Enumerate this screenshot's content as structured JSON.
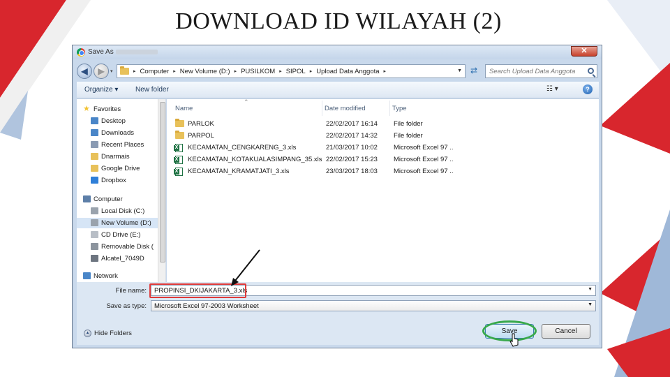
{
  "slide": {
    "title": "DOWNLOAD ID WILAYAH (2)"
  },
  "dialog": {
    "title": "Save As",
    "close_label": "✕",
    "breadcrumbs": [
      "Computer",
      "New Volume (D:)",
      "PUSILKOM",
      "SIPOL",
      "Upload Data Anggota"
    ],
    "search_placeholder": "Search Upload Data Anggota",
    "toolbar": {
      "organize": "Organize ▾",
      "new_folder": "New folder",
      "view": "☷ ▾",
      "help": "?"
    },
    "nav_pane": [
      {
        "label": "Favorites",
        "icon": "star-icon",
        "indent": 0,
        "selected": false
      },
      {
        "label": "Desktop",
        "icon": "desktop-icon",
        "indent": 1,
        "selected": false
      },
      {
        "label": "Downloads",
        "icon": "downloads-icon",
        "indent": 1,
        "selected": false
      },
      {
        "label": "Recent Places",
        "icon": "recent-places-icon",
        "indent": 1,
        "selected": false
      },
      {
        "label": "Dnarmais",
        "icon": "folder-icon",
        "indent": 1,
        "selected": false
      },
      {
        "label": "Google Drive",
        "icon": "google-drive-icon",
        "indent": 1,
        "selected": false
      },
      {
        "label": "Dropbox",
        "icon": "dropbox-icon",
        "indent": 1,
        "selected": false
      },
      {
        "label": "Computer",
        "icon": "computer-icon",
        "indent": 0,
        "selected": false
      },
      {
        "label": "Local Disk (C:)",
        "icon": "disk-icon",
        "indent": 1,
        "selected": false
      },
      {
        "label": "New Volume (D:)",
        "icon": "disk-icon",
        "indent": 1,
        "selected": true
      },
      {
        "label": "CD Drive (E:)",
        "icon": "cd-drive-icon",
        "indent": 1,
        "selected": false
      },
      {
        "label": "Removable Disk (",
        "icon": "removable-disk-icon",
        "indent": 1,
        "selected": false
      },
      {
        "label": "Alcatel_7049D",
        "icon": "phone-icon",
        "indent": 1,
        "selected": false
      },
      {
        "label": "Network",
        "icon": "network-icon",
        "indent": 0,
        "selected": false
      }
    ],
    "columns": {
      "name": "Name",
      "date": "Date modified",
      "type": "Type"
    },
    "files": [
      {
        "name": "PARLOK",
        "date": "22/02/2017 16:14",
        "type": "File folder",
        "kind": "folder"
      },
      {
        "name": "PARPOL",
        "date": "22/02/2017 14:32",
        "type": "File folder",
        "kind": "folder"
      },
      {
        "name": "KECAMATAN_CENGKARENG_3.xls",
        "date": "21/03/2017 10:02",
        "type": "Microsoft Excel 97 ..",
        "kind": "xls"
      },
      {
        "name": "KECAMATAN_KOTAKUALASIMPANG_35.xls",
        "date": "22/02/2017 15:23",
        "type": "Microsoft Excel 97 ..",
        "kind": "xls"
      },
      {
        "name": "KECAMATAN_KRAMATJATI_3.xls",
        "date": "23/03/2017 18:03",
        "type": "Microsoft Excel 97 ..",
        "kind": "xls"
      }
    ],
    "file_name_label": "File name:",
    "file_name_value": "PROPINSI_DKIJAKARTA_3.xls",
    "save_type_label": "Save as type:",
    "save_type_value": "Microsoft Excel 97-2003 Worksheet",
    "hide_folders": "Hide Folders",
    "save_button": "Save",
    "cancel_button": "Cancel"
  },
  "colors": {
    "highlight_red": "#e03a3a",
    "highlight_green": "#37a84a",
    "deco_red": "#d8262d",
    "deco_blue": "#9fb8d8"
  }
}
